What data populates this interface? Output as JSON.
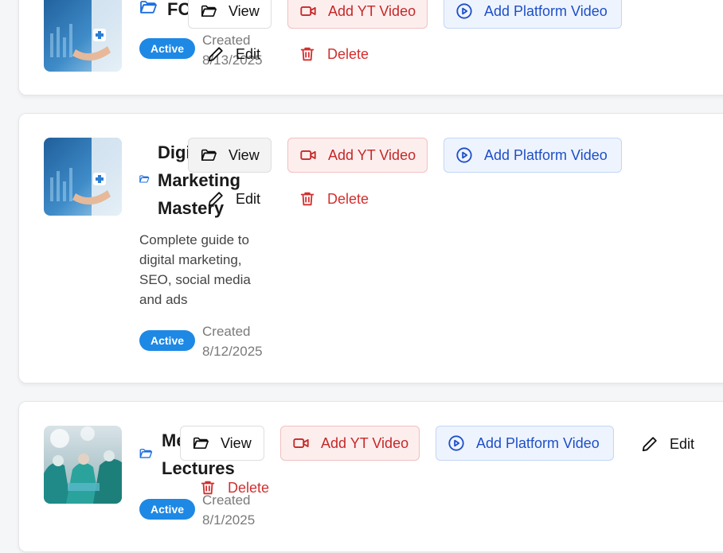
{
  "colors": {
    "badge": "#1e88e5",
    "danger": "#d32f2f",
    "primary": "#1e4fc7"
  },
  "icons": {
    "folder": "folder-open-icon",
    "view": "folder-open-icon",
    "yt": "video-camera-icon",
    "platform": "play-circle-icon",
    "edit": "pencil-icon",
    "delete": "trash-icon"
  },
  "courses": [
    {
      "title": "FO",
      "status": "Active",
      "created_label": "Created",
      "created_date": "8/13/2025",
      "actions": {
        "view": "View",
        "add_yt": "Add YT Video",
        "add_platform": "Add Platform Video",
        "edit": "Edit",
        "delete": "Delete"
      }
    },
    {
      "title_lines": [
        "Digi",
        "Marketing",
        "Mastery"
      ],
      "description": "Complete guide to digital marketing, SEO, social media and ads",
      "status": "Active",
      "created_label": "Created",
      "created_date": "8/12/2025",
      "actions": {
        "view": "View",
        "add_yt": "Add YT Video",
        "add_platform": "Add Platform Video",
        "edit": "Edit",
        "delete": "Delete"
      }
    },
    {
      "title_lines": [
        "Me",
        "Lectures"
      ],
      "status": "Active",
      "created_label": "Created",
      "created_date": "8/1/2025",
      "actions": {
        "view": "View",
        "add_yt": "Add YT Video",
        "add_platform": "Add Platform Video",
        "edit": "Edit",
        "delete": "Delete"
      }
    }
  ]
}
